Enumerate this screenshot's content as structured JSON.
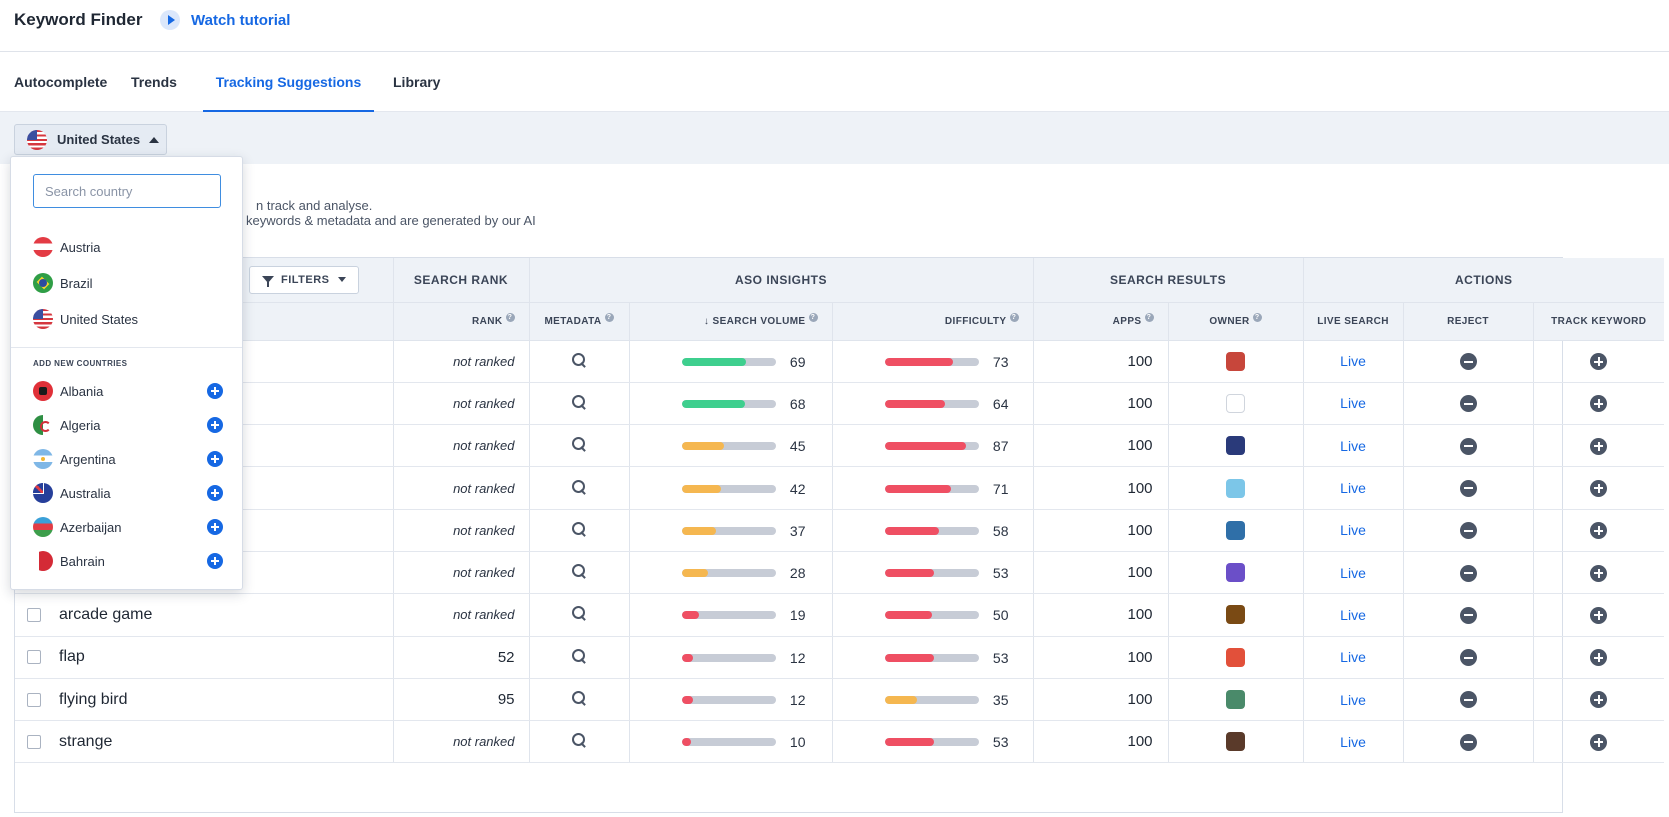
{
  "header": {
    "title": "Keyword Finder",
    "tutorial_label": "Watch tutorial"
  },
  "tabs": [
    {
      "label": "Autocomplete",
      "active": false
    },
    {
      "label": "Trends",
      "active": false
    },
    {
      "label": "Tracking Suggestions",
      "active": true
    },
    {
      "label": "Library",
      "active": false
    }
  ],
  "country_selector": {
    "selected": "United States",
    "search_placeholder": "Search country",
    "selected_countries": [
      {
        "name": "Austria",
        "flag": "flag-at"
      },
      {
        "name": "Brazil",
        "flag": "flag-br"
      },
      {
        "name": "United States",
        "flag": "flag-us"
      }
    ],
    "add_section_title": "ADD NEW COUNTRIES",
    "add_countries": [
      {
        "name": "Albania",
        "flag": "flag-al"
      },
      {
        "name": "Algeria",
        "flag": "flag-dz"
      },
      {
        "name": "Argentina",
        "flag": "flag-ar"
      },
      {
        "name": "Australia",
        "flag": "flag-au"
      },
      {
        "name": "Azerbaijan",
        "flag": "flag-az"
      },
      {
        "name": "Bahrain",
        "flag": "flag-bh"
      }
    ]
  },
  "intro": {
    "line1": "n track and analyse.",
    "line2": " keywords & metadata and are generated by our AI"
  },
  "table": {
    "filters_label": "FILTERS",
    "groups": {
      "search_rank": "SEARCH RANK",
      "aso_insights": "ASO INSIGHTS",
      "search_results": "SEARCH RESULTS",
      "actions": "ACTIONS"
    },
    "columns": {
      "rank": "RANK",
      "metadata": "METADATA",
      "search_volume": "SEARCH VOLUME",
      "difficulty": "DIFFICULTY",
      "apps": "APPS",
      "owner": "OWNER",
      "live_search": "LIVE SEARCH",
      "reject": "REJECT",
      "track_keyword": "TRACK KEYWORD"
    },
    "live_label": "Live",
    "colors": {
      "green": "#3ecf8e",
      "orange": "#f5b750",
      "red": "#ef4f63"
    },
    "rows": [
      {
        "keyword": "",
        "rank": "not ranked",
        "volume": 69,
        "volume_color": "green",
        "difficulty": 73,
        "difficulty_color": "red",
        "apps": "100",
        "owner_color": "#c7463b"
      },
      {
        "keyword": "",
        "rank": "not ranked",
        "volume": 68,
        "volume_color": "green",
        "difficulty": 64,
        "difficulty_color": "red",
        "apps": "100",
        "owner_color": "#ffffff"
      },
      {
        "keyword": "",
        "rank": "not ranked",
        "volume": 45,
        "volume_color": "orange",
        "difficulty": 87,
        "difficulty_color": "red",
        "apps": "100",
        "owner_color": "#2a3a7a"
      },
      {
        "keyword": "",
        "rank": "not ranked",
        "volume": 42,
        "volume_color": "orange",
        "difficulty": 71,
        "difficulty_color": "red",
        "apps": "100",
        "owner_color": "#7cc6e8"
      },
      {
        "keyword": "",
        "rank": "not ranked",
        "volume": 37,
        "volume_color": "orange",
        "difficulty": 58,
        "difficulty_color": "red",
        "apps": "100",
        "owner_color": "#2f6fa8"
      },
      {
        "keyword": "",
        "rank": "not ranked",
        "volume": 28,
        "volume_color": "orange",
        "difficulty": 53,
        "difficulty_color": "red",
        "apps": "100",
        "owner_color": "#6b4fc8"
      },
      {
        "keyword": "arcade game",
        "rank": "not ranked",
        "volume": 19,
        "volume_color": "red",
        "difficulty": 50,
        "difficulty_color": "red",
        "apps": "100",
        "owner_color": "#7a4a14"
      },
      {
        "keyword": "flap",
        "rank": "52",
        "volume": 12,
        "volume_color": "red",
        "difficulty": 53,
        "difficulty_color": "red",
        "apps": "100",
        "owner_color": "#e2503a"
      },
      {
        "keyword": "flying bird",
        "rank": "95",
        "volume": 12,
        "volume_color": "red",
        "difficulty": 35,
        "difficulty_color": "orange",
        "apps": "100",
        "owner_color": "#4a8a6a"
      },
      {
        "keyword": "strange",
        "rank": "not ranked",
        "volume": 10,
        "volume_color": "red",
        "difficulty": 53,
        "difficulty_color": "red",
        "apps": "100",
        "owner_color": "#5a3a2a"
      }
    ]
  }
}
